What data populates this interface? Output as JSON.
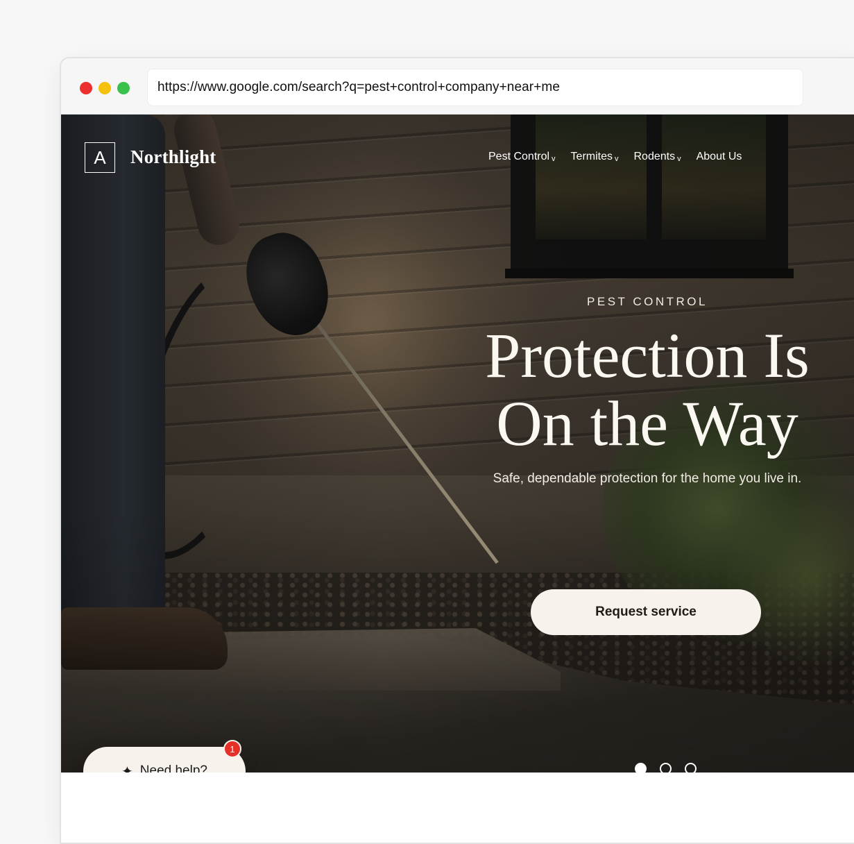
{
  "browser": {
    "url": "https://www.google.com/search?q=pest+control+company+near+me"
  },
  "site": {
    "logo_letter": "A",
    "brand": "Northlight",
    "nav": [
      {
        "label": "Pest Control",
        "dropdown": true
      },
      {
        "label": "Termites",
        "dropdown": true
      },
      {
        "label": "Rodents",
        "dropdown": true
      },
      {
        "label": "About Us",
        "dropdown": false
      }
    ],
    "caret": "v"
  },
  "hero": {
    "eyebrow": "PEST CONTROL",
    "headline_line1": "Protection Is",
    "headline_line2": "On the Way",
    "subhead": "Safe, dependable protection for the home you live in.",
    "cta": "Request service",
    "slides": 3,
    "active_slide": 1
  },
  "help": {
    "icon": "sparkle-icon",
    "label": "Need help?",
    "badge_count": "1"
  },
  "colors": {
    "button_bg": "#f7f3ec",
    "badge": "#e5302a",
    "traffic_red": "#ec2f2f",
    "traffic_yellow": "#f4c20d",
    "traffic_green": "#39c14b"
  }
}
